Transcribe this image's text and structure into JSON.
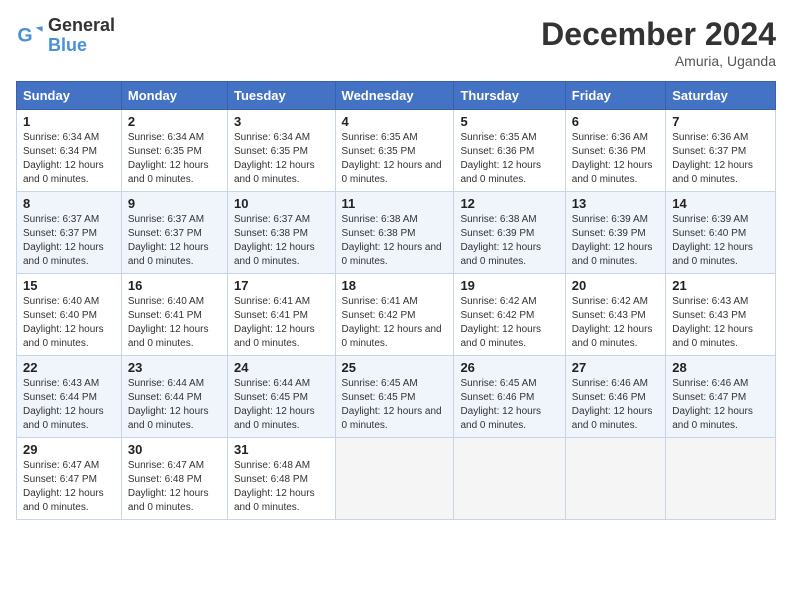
{
  "logo": {
    "line1": "General",
    "line2": "Blue"
  },
  "title": "December 2024",
  "subtitle": "Amuria, Uganda",
  "days_of_week": [
    "Sunday",
    "Monday",
    "Tuesday",
    "Wednesday",
    "Thursday",
    "Friday",
    "Saturday"
  ],
  "weeks": [
    [
      {
        "num": "1",
        "sunrise": "6:34 AM",
        "sunset": "6:34 PM",
        "daylight": "12 hours and 0 minutes."
      },
      {
        "num": "2",
        "sunrise": "6:34 AM",
        "sunset": "6:35 PM",
        "daylight": "12 hours and 0 minutes."
      },
      {
        "num": "3",
        "sunrise": "6:34 AM",
        "sunset": "6:35 PM",
        "daylight": "12 hours and 0 minutes."
      },
      {
        "num": "4",
        "sunrise": "6:35 AM",
        "sunset": "6:35 PM",
        "daylight": "12 hours and 0 minutes."
      },
      {
        "num": "5",
        "sunrise": "6:35 AM",
        "sunset": "6:36 PM",
        "daylight": "12 hours and 0 minutes."
      },
      {
        "num": "6",
        "sunrise": "6:36 AM",
        "sunset": "6:36 PM",
        "daylight": "12 hours and 0 minutes."
      },
      {
        "num": "7",
        "sunrise": "6:36 AM",
        "sunset": "6:37 PM",
        "daylight": "12 hours and 0 minutes."
      }
    ],
    [
      {
        "num": "8",
        "sunrise": "6:37 AM",
        "sunset": "6:37 PM",
        "daylight": "12 hours and 0 minutes."
      },
      {
        "num": "9",
        "sunrise": "6:37 AM",
        "sunset": "6:37 PM",
        "daylight": "12 hours and 0 minutes."
      },
      {
        "num": "10",
        "sunrise": "6:37 AM",
        "sunset": "6:38 PM",
        "daylight": "12 hours and 0 minutes."
      },
      {
        "num": "11",
        "sunrise": "6:38 AM",
        "sunset": "6:38 PM",
        "daylight": "12 hours and 0 minutes."
      },
      {
        "num": "12",
        "sunrise": "6:38 AM",
        "sunset": "6:39 PM",
        "daylight": "12 hours and 0 minutes."
      },
      {
        "num": "13",
        "sunrise": "6:39 AM",
        "sunset": "6:39 PM",
        "daylight": "12 hours and 0 minutes."
      },
      {
        "num": "14",
        "sunrise": "6:39 AM",
        "sunset": "6:40 PM",
        "daylight": "12 hours and 0 minutes."
      }
    ],
    [
      {
        "num": "15",
        "sunrise": "6:40 AM",
        "sunset": "6:40 PM",
        "daylight": "12 hours and 0 minutes."
      },
      {
        "num": "16",
        "sunrise": "6:40 AM",
        "sunset": "6:41 PM",
        "daylight": "12 hours and 0 minutes."
      },
      {
        "num": "17",
        "sunrise": "6:41 AM",
        "sunset": "6:41 PM",
        "daylight": "12 hours and 0 minutes."
      },
      {
        "num": "18",
        "sunrise": "6:41 AM",
        "sunset": "6:42 PM",
        "daylight": "12 hours and 0 minutes."
      },
      {
        "num": "19",
        "sunrise": "6:42 AM",
        "sunset": "6:42 PM",
        "daylight": "12 hours and 0 minutes."
      },
      {
        "num": "20",
        "sunrise": "6:42 AM",
        "sunset": "6:43 PM",
        "daylight": "12 hours and 0 minutes."
      },
      {
        "num": "21",
        "sunrise": "6:43 AM",
        "sunset": "6:43 PM",
        "daylight": "12 hours and 0 minutes."
      }
    ],
    [
      {
        "num": "22",
        "sunrise": "6:43 AM",
        "sunset": "6:44 PM",
        "daylight": "12 hours and 0 minutes."
      },
      {
        "num": "23",
        "sunrise": "6:44 AM",
        "sunset": "6:44 PM",
        "daylight": "12 hours and 0 minutes."
      },
      {
        "num": "24",
        "sunrise": "6:44 AM",
        "sunset": "6:45 PM",
        "daylight": "12 hours and 0 minutes."
      },
      {
        "num": "25",
        "sunrise": "6:45 AM",
        "sunset": "6:45 PM",
        "daylight": "12 hours and 0 minutes."
      },
      {
        "num": "26",
        "sunrise": "6:45 AM",
        "sunset": "6:46 PM",
        "daylight": "12 hours and 0 minutes."
      },
      {
        "num": "27",
        "sunrise": "6:46 AM",
        "sunset": "6:46 PM",
        "daylight": "12 hours and 0 minutes."
      },
      {
        "num": "28",
        "sunrise": "6:46 AM",
        "sunset": "6:47 PM",
        "daylight": "12 hours and 0 minutes."
      }
    ],
    [
      {
        "num": "29",
        "sunrise": "6:47 AM",
        "sunset": "6:47 PM",
        "daylight": "12 hours and 0 minutes."
      },
      {
        "num": "30",
        "sunrise": "6:47 AM",
        "sunset": "6:48 PM",
        "daylight": "12 hours and 0 minutes."
      },
      {
        "num": "31",
        "sunrise": "6:48 AM",
        "sunset": "6:48 PM",
        "daylight": "12 hours and 0 minutes."
      },
      null,
      null,
      null,
      null
    ]
  ]
}
